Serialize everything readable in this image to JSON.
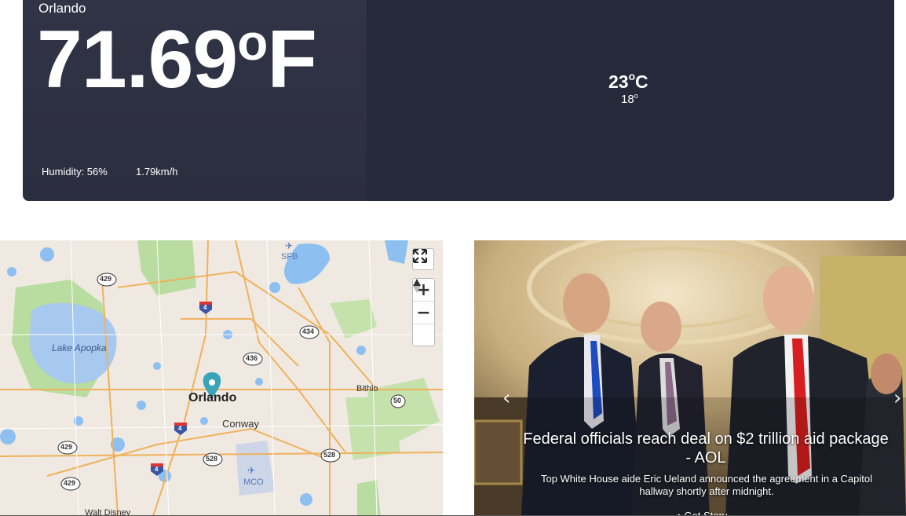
{
  "weather": {
    "city": "Orlando",
    "temperature": "71.69",
    "temperature_unit": "F",
    "humidity": "Humidity: 56%",
    "wind": "1.79km/h",
    "forecast_high": "23",
    "forecast_high_unit": "C",
    "forecast_low": "18"
  },
  "map": {
    "labels": {
      "lake": "Lake Apopka",
      "orlando": "Orlando",
      "conway": "Conway",
      "bithlo": "Bithlo",
      "walt_disney": "Walt Disney",
      "sfb": "SFB",
      "mco": "MCO"
    },
    "shields": [
      "429",
      "434",
      "436",
      "50",
      "429",
      "429",
      "528",
      "528",
      "4",
      "4",
      "4"
    ]
  },
  "news": {
    "title": "Federal officials reach deal on $2 trillion aid package - AOL",
    "description": "Top White House aide Eric Ueland announced the agreement in a Capitol hallway shortly after midnight.",
    "link_label": "Get Story",
    "prev_icon": "chevron-left-icon",
    "next_icon": "chevron-right-icon"
  }
}
